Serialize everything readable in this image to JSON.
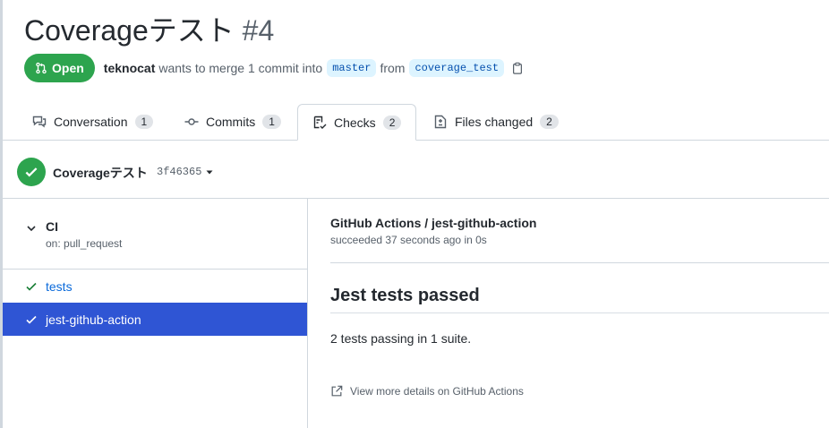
{
  "pr": {
    "title": "Coverageテスト",
    "number": "#4",
    "state": "Open",
    "author": "teknocat",
    "merge_text": "wants to merge 1 commit into",
    "base_branch": "master",
    "from_text": "from",
    "head_branch": "coverage_test"
  },
  "tabs": [
    {
      "label": "Conversation",
      "count": "1",
      "icon": "comment-icon"
    },
    {
      "label": "Commits",
      "count": "1",
      "icon": "commit-icon"
    },
    {
      "label": "Checks",
      "count": "2",
      "icon": "checklist-icon"
    },
    {
      "label": "Files changed",
      "count": "2",
      "icon": "file-diff-icon"
    }
  ],
  "commit": {
    "name": "Coverageテスト",
    "sha": "3f46365"
  },
  "sidebar": {
    "suite_name": "CI",
    "suite_event": "on: pull_request",
    "runs": [
      {
        "label": "tests",
        "selected": false
      },
      {
        "label": "jest-github-action",
        "selected": true
      }
    ]
  },
  "detail": {
    "app": "GitHub Actions / jest-github-action",
    "status": "succeeded 37 seconds ago in 0s",
    "heading": "Jest tests passed",
    "summary": "2 tests passing in 1 suite.",
    "view_more": "View more details on GitHub Actions"
  },
  "colors": {
    "success": "#2da44e",
    "selected": "#2f55d4",
    "link": "#0969da"
  }
}
